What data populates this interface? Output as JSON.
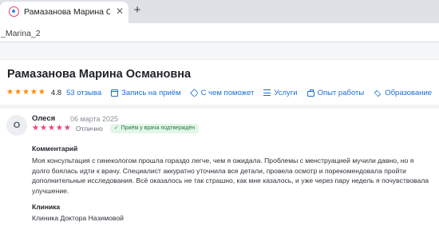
{
  "browser": {
    "tab_title": "Рамазанова Марина Османо",
    "close_glyph": "✕",
    "new_tab_glyph": "+",
    "address_text": "_Marina_2"
  },
  "doctor": {
    "name": "Рамазанова Марина Османовна",
    "rating": "4.8",
    "reviews_count_label": "53 отзыва",
    "stars": 5,
    "star_color": "#ff8a00",
    "nav": [
      {
        "label": "Запись на приём",
        "icon": "calendar-icon"
      },
      {
        "label": "С чем поможет",
        "icon": "tag-icon"
      },
      {
        "label": "Услуги",
        "icon": "list-icon"
      },
      {
        "label": "Опыт работы",
        "icon": "briefcase-icon"
      },
      {
        "label": "Образование",
        "icon": "graduation-cap-icon"
      }
    ],
    "link_color": "#1a6fd4"
  },
  "review": {
    "avatar_letter": "О",
    "author": "Олеся",
    "date": "06 марта 2025",
    "stars": 5,
    "star_color": "#ee3e7f",
    "grade": "Отлично",
    "badge": "Приём у врача подтверждён",
    "comment_title": "Комментарий",
    "comment_text": "Моя консультация с гинекологом прошла гораздо легче, чем я ожидала. Проблемы с менструацией мучили давно, но я долго боялась идти к врачу. Специалист аккуратно уточнила все детали, провела осмотр и порекомендовала пройти дополнительные исследования. Всё оказалось не так страшно, как мне казалось, и уже через пару недель я почувствовала улучшение.",
    "clinic_title": "Клиника",
    "clinic_name": "Клиника Доктора Назимовой"
  }
}
